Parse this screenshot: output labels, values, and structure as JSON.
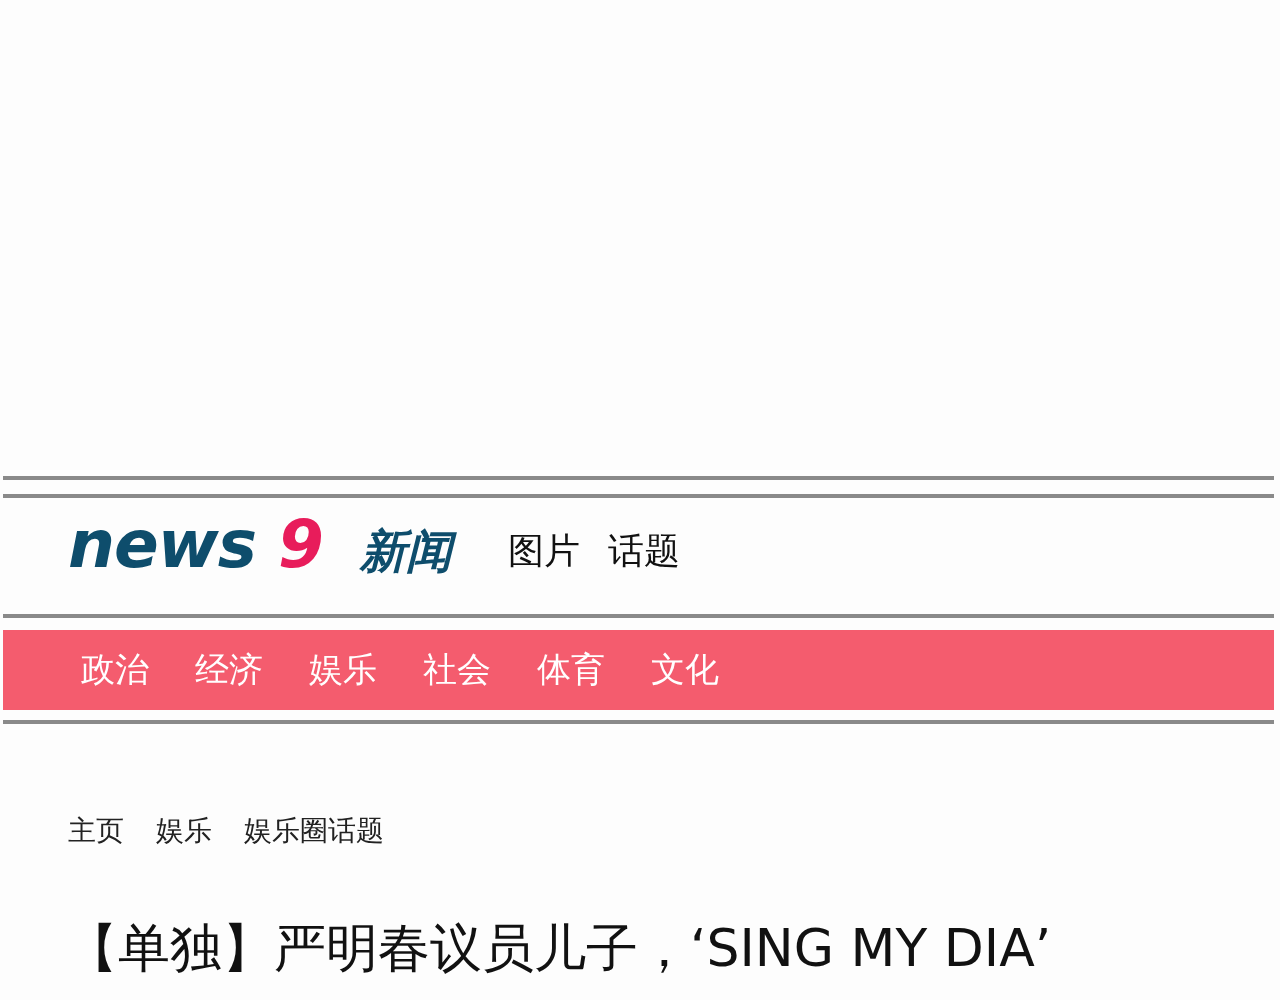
{
  "logo": {
    "word": "news",
    "number": "9",
    "name": "新闻"
  },
  "header_links": [
    "图片",
    "话题"
  ],
  "categories": [
    "政治",
    "经济",
    "娱乐",
    "社会",
    "体育",
    "文化"
  ],
  "breadcrumb": [
    "主页",
    "娱乐",
    "娱乐圈话题"
  ],
  "headline": "【单独】严明春议员儿子，‘SING MY DIA’"
}
